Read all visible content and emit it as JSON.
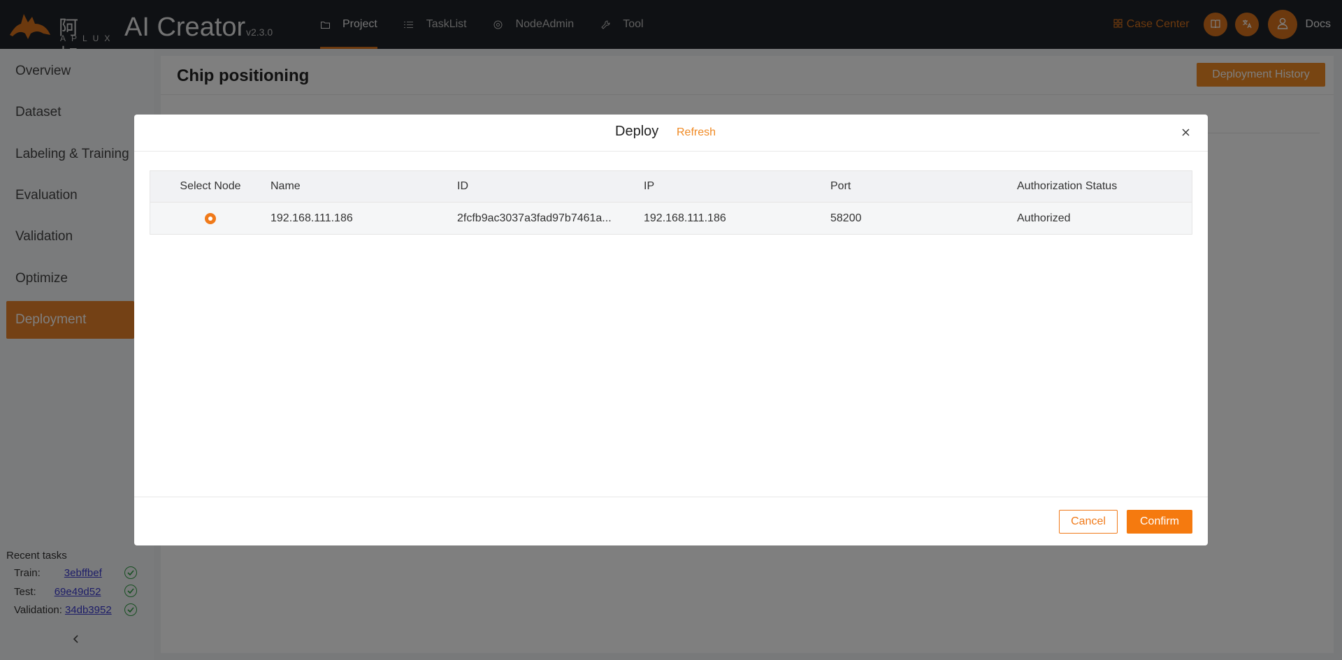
{
  "header": {
    "brand_cn": "阿加犀",
    "brand_aplux": "APLUX",
    "app_title": "AI Creator",
    "version": "v2.3.0",
    "nav": [
      {
        "label": "Project",
        "icon": "folder-icon",
        "active": true
      },
      {
        "label": "TaskList",
        "icon": "list-icon",
        "active": false
      },
      {
        "label": "NodeAdmin",
        "icon": "node-icon",
        "active": false
      },
      {
        "label": "Tool",
        "icon": "wrench-icon",
        "active": false
      }
    ],
    "case_center": "Case Center",
    "docs": "Docs",
    "accent_color": "#d9731d"
  },
  "sidebar": {
    "items": [
      {
        "label": "Overview"
      },
      {
        "label": "Dataset"
      },
      {
        "label": "Labeling & Training"
      },
      {
        "label": "Evaluation"
      },
      {
        "label": "Validation"
      },
      {
        "label": "Optimize"
      },
      {
        "label": "Deployment",
        "active": true
      }
    ],
    "recent_title": "Recent tasks",
    "recent": [
      {
        "label": "Train:",
        "id": "3ebffbef",
        "status": "success"
      },
      {
        "label": "Test:",
        "id": "69e49d52",
        "status": "success"
      },
      {
        "label": "Validation:",
        "id": "34db3952",
        "status": "success"
      }
    ]
  },
  "main": {
    "title": "Chip positioning",
    "deployment_history": "Deployment History"
  },
  "modal": {
    "title": "Deploy",
    "refresh": "Refresh",
    "columns": [
      "Select Node",
      "Name",
      "ID",
      "IP",
      "Port",
      "Authorization Status"
    ],
    "rows": [
      {
        "selected": true,
        "name": "192.168.111.186",
        "id": "2fcfb9ac3037a3fad97b7461a...",
        "ip": "192.168.111.186",
        "port": "58200",
        "status": "Authorized"
      }
    ],
    "cancel": "Cancel",
    "confirm": "Confirm"
  }
}
